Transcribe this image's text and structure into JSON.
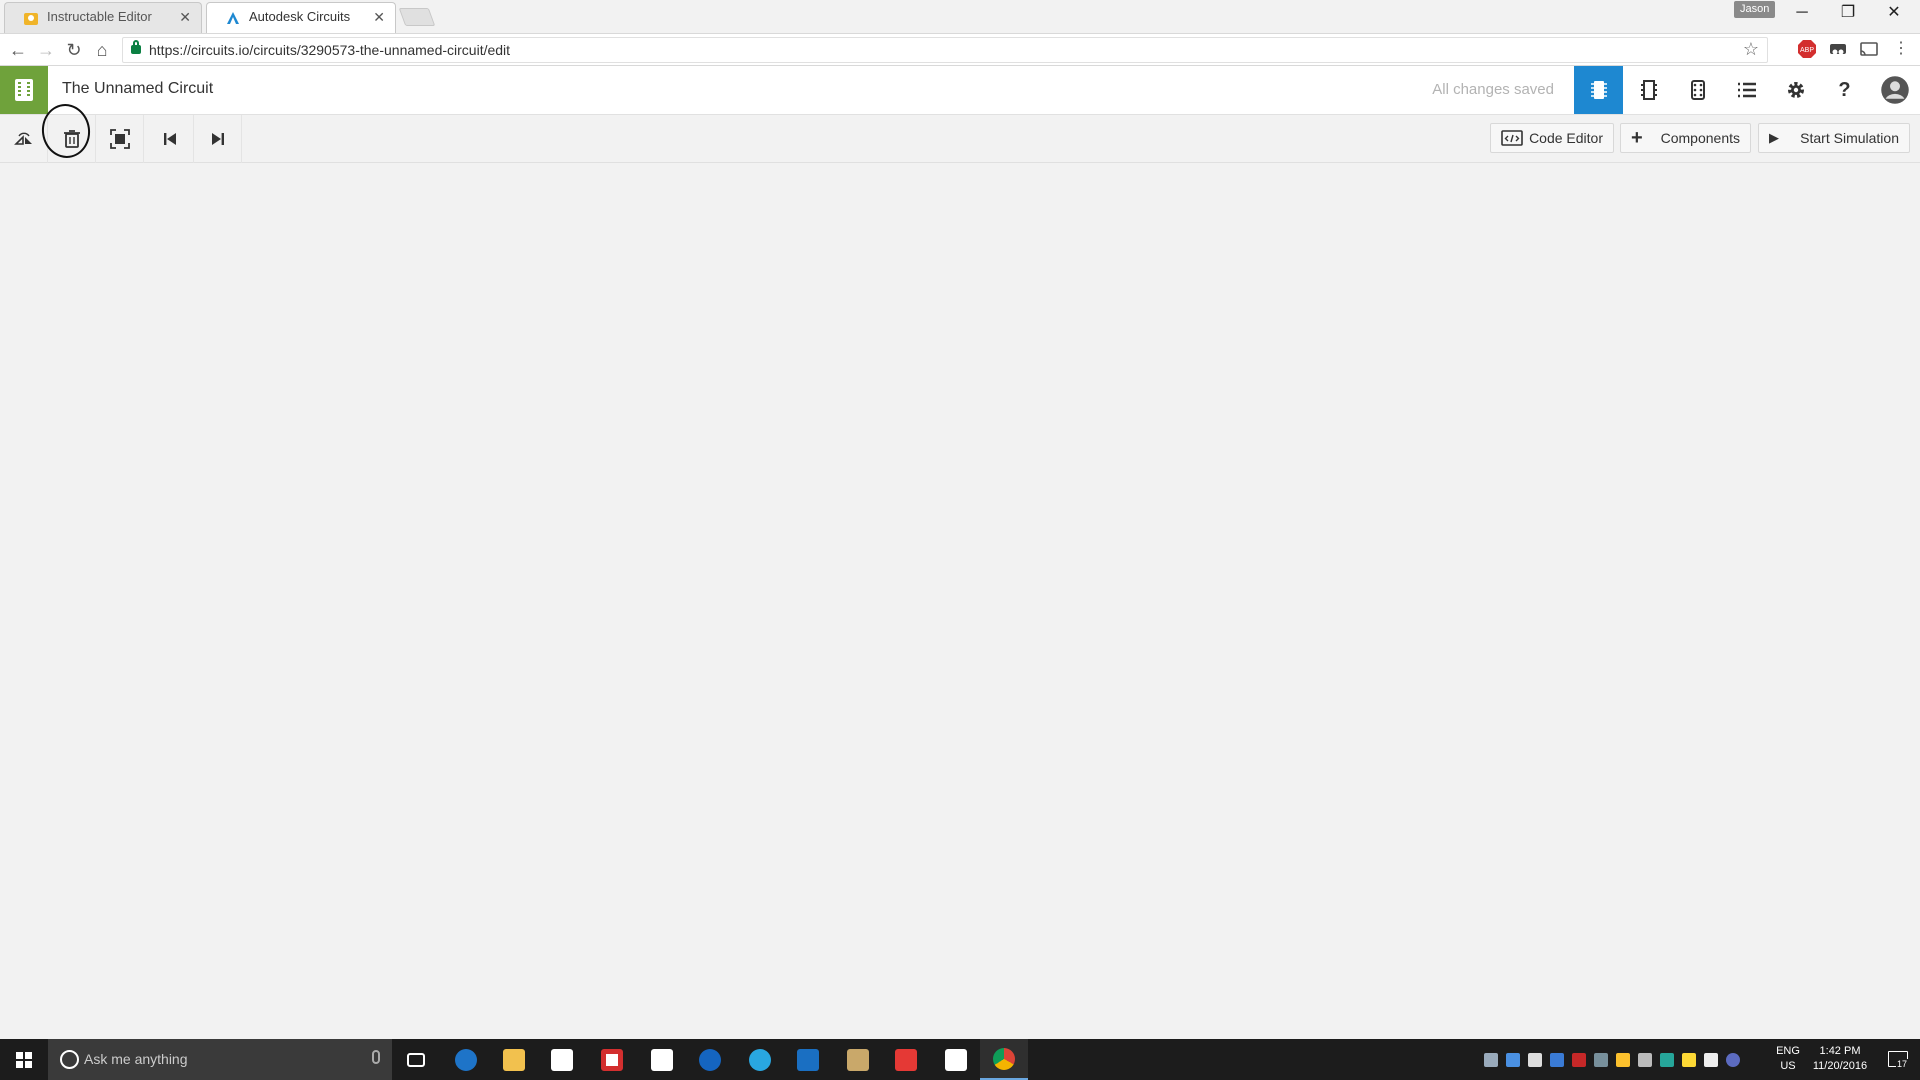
{
  "browser": {
    "tabs": [
      {
        "title": "Instructable Editor",
        "active": false
      },
      {
        "title": "Autodesk Circuits",
        "active": true
      }
    ],
    "profile_name": "Jason",
    "url": "https://circuits.io/circuits/3290573-the-unnamed-circuit/edit"
  },
  "app": {
    "title": "The Unnamed Circuit",
    "save_status": "All changes saved",
    "accent_color": "#1e88d1",
    "logo_color": "#6fa23b",
    "view_buttons": [
      "breadboard-view-icon",
      "schematic-view-icon",
      "pcb-view-icon",
      "component-list-icon",
      "settings-icon",
      "help-icon",
      "user-avatar"
    ]
  },
  "edit_toolbar": {
    "tools": [
      "rotate-icon",
      "delete-icon",
      "zoom-to-fit-icon",
      "skip-back-icon",
      "skip-forward-icon"
    ],
    "code_editor_label": "Code Editor",
    "components_label": "Components",
    "start_simulation_label": "Start Simulation"
  },
  "taskbar": {
    "search_placeholder": "Ask me anything",
    "language": "ENG",
    "region": "US",
    "time": "1:42 PM",
    "date": "11/20/2016",
    "notifications": "17"
  }
}
